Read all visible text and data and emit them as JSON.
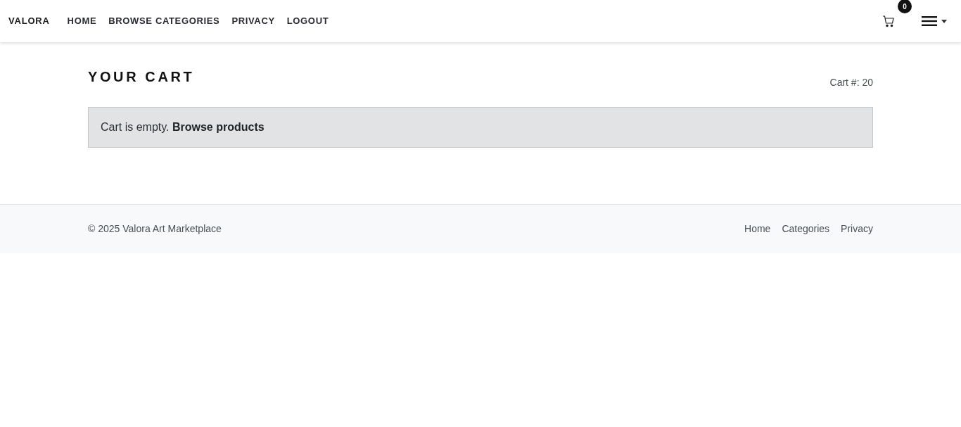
{
  "navbar": {
    "brand": "VALORA",
    "links": [
      "HOME",
      "BROWSE CATEGORIES",
      "PRIVACY",
      "LOGOUT"
    ],
    "cart_badge": "0"
  },
  "page": {
    "title": "YOUR CART",
    "cart_number": "Cart #: 20"
  },
  "alert": {
    "text": "Cart is empty.",
    "link": "Browse products"
  },
  "footer": {
    "copyright": "© 2025 Valora Art Marketplace",
    "links": [
      "Home",
      "Categories",
      "Privacy"
    ]
  }
}
